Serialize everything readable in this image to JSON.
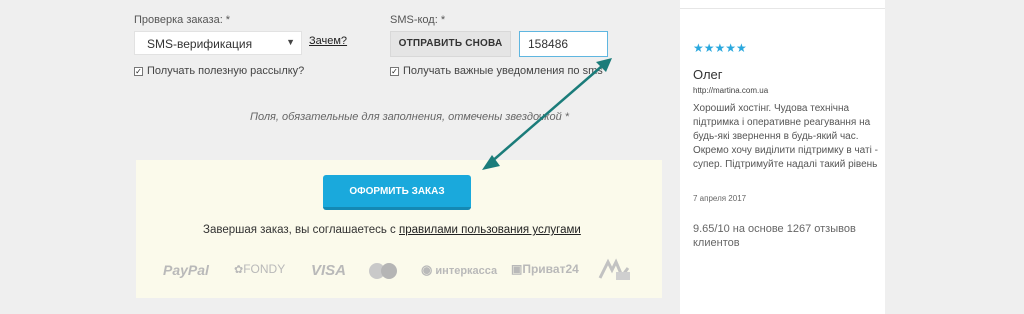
{
  "verify": {
    "label": "Проверка заказа: *",
    "select_value": "SMS-верификация",
    "why_link": "Зачем?",
    "newsletter": "Получать полезную рассылку?"
  },
  "sms": {
    "label": "SMS-код: *",
    "resend_button": "ОТПРАВИТЬ СНОВА",
    "code_value": "158486",
    "notify": "Получать важные уведомления по sms"
  },
  "required_note": "Поля, обязательные для заполнения, отмечены звездочкой *",
  "order": {
    "button": "ОФОРМИТЬ ЗАКАЗ",
    "agree_prefix": "Завершая заказ, вы соглашаетесь с ",
    "agree_link": "правилами пользования услугами"
  },
  "payments": [
    "PayPal",
    "FONDY",
    "VISA",
    "MasterCard",
    "интеркасса",
    "Приват24",
    "Webmoney"
  ],
  "review": {
    "stars": "★★★★★",
    "name": "Олег",
    "site": "http://martina.com.ua",
    "text": "Хороший хостінг. Чудова технічна підтримка і оперативне реагування на будь-які звернення в будь-який час. Окремо хочу виділити підтримку в чаті - супер. Підтримуйте надалі такий рівень",
    "date": "7 апреля 2017"
  },
  "rating_text": "9.65/10 на основе 1267 отзывов клиентов",
  "colors": {
    "accent": "#1aa9dc",
    "arrow": "#1b7c7a",
    "panel": "#fbfaeb"
  }
}
